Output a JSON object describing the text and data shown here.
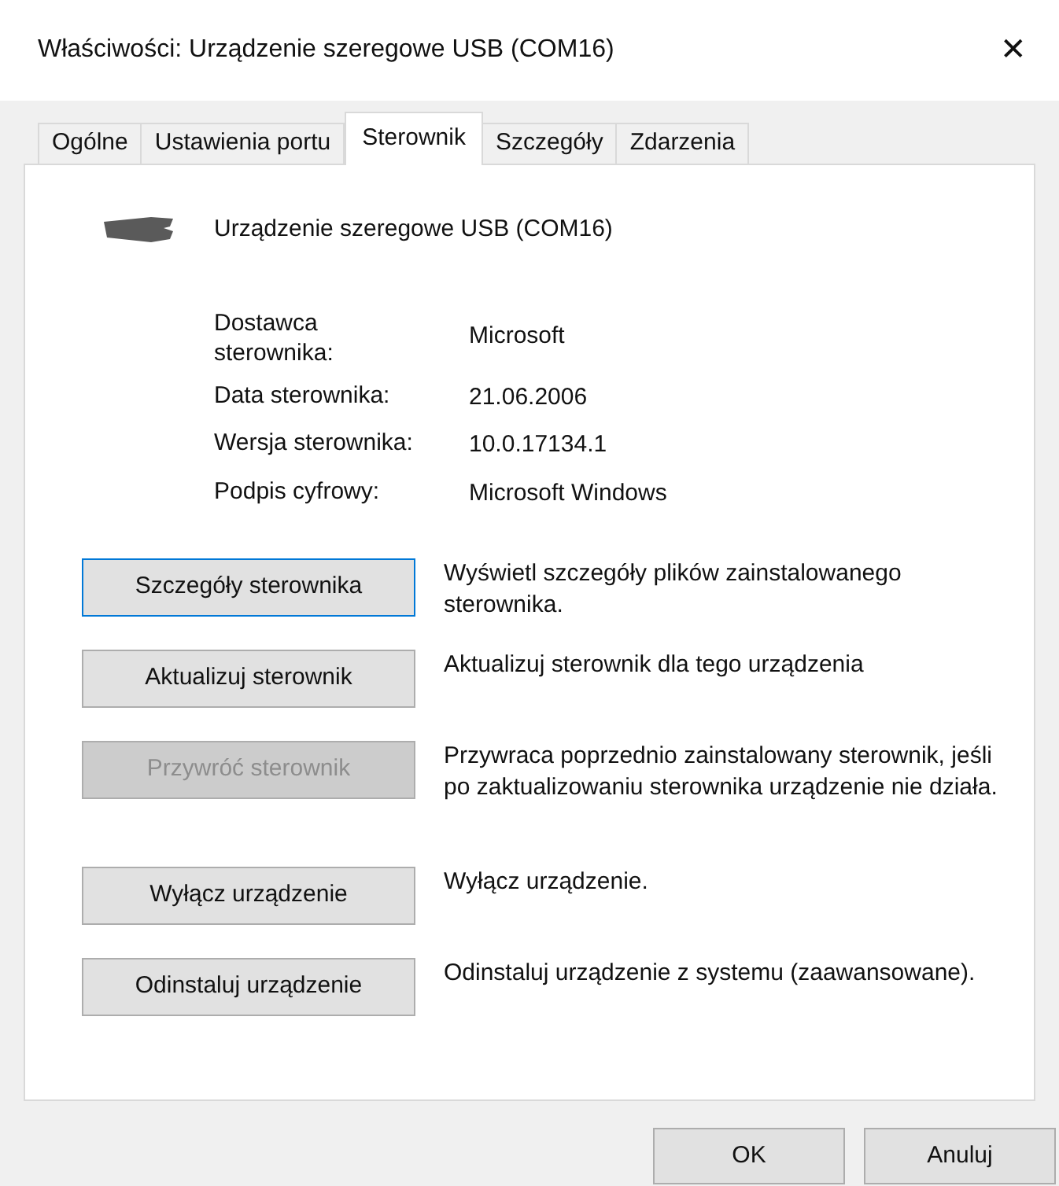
{
  "window": {
    "title": "Właściwości: Urządzenie szeregowe USB (COM16)",
    "close": "✕"
  },
  "tabs": [
    {
      "label": "Ogólne",
      "selected": false
    },
    {
      "label": "Ustawienia portu",
      "selected": false
    },
    {
      "label": "Sterownik",
      "selected": true
    },
    {
      "label": "Szczegóły",
      "selected": false
    },
    {
      "label": "Zdarzenia",
      "selected": false
    }
  ],
  "device": {
    "name": "Urządzenie szeregowe USB (COM16)"
  },
  "properties": [
    {
      "label": "Dostawca sterownika:",
      "value": "Microsoft"
    },
    {
      "label": "Data sterownika:",
      "value": "21.06.2006"
    },
    {
      "label": "Wersja sterownika:",
      "value": "10.0.17134.1"
    },
    {
      "label": "Podpis cyfrowy:",
      "value": "Microsoft Windows"
    }
  ],
  "actions": [
    {
      "button": "Szczegóły sterownika",
      "description": "Wyświetl szczegóły plików zainstalowanego sterownika.",
      "disabled": false,
      "focused": true
    },
    {
      "button": "Aktualizuj sterownik",
      "description": "Aktualizuj sterownik dla tego urządzenia",
      "disabled": false,
      "focused": false
    },
    {
      "button": "Przywróć sterownik",
      "description": "Przywraca poprzednio zainstalowany sterownik, jeśli po zaktualizowaniu sterownika urządzenie nie działa.",
      "disabled": true,
      "focused": false
    },
    {
      "button": "Wyłącz urządzenie",
      "description": "Wyłącz urządzenie.",
      "disabled": false,
      "focused": false
    },
    {
      "button": "Odinstaluj urządzenie",
      "description": "Odinstaluj urządzenie z systemu (zaawansowane).",
      "disabled": false,
      "focused": false
    }
  ],
  "footer_buttons": [
    "OK",
    "Anuluj"
  ]
}
